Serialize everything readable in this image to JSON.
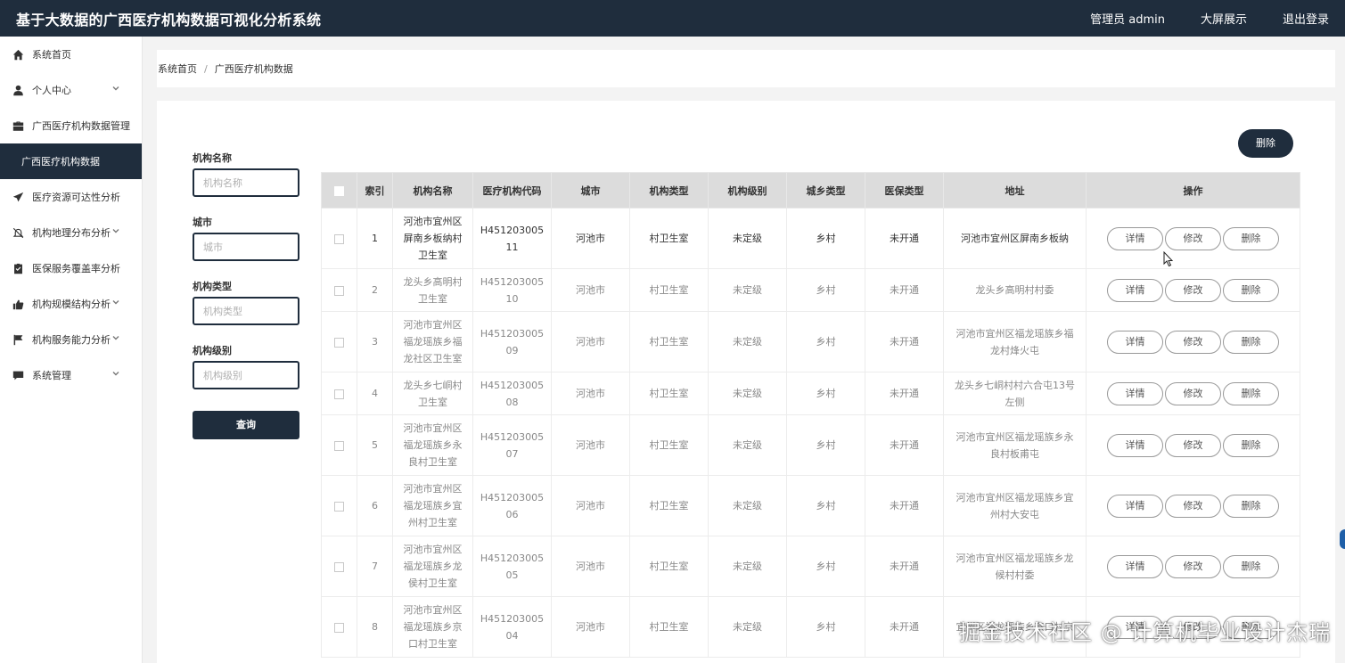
{
  "app": {
    "title": "基于大数据的广西医疗机构数据可视化分析系统",
    "admin_label": "管理员 admin",
    "bigscreen_label": "大屏展示",
    "logout_label": "退出登录"
  },
  "sidebar": {
    "items": [
      {
        "label": "系统首页",
        "icon": "home-icon"
      },
      {
        "label": "个人中心",
        "icon": "user-icon",
        "chevron": true
      },
      {
        "label": "广西医疗机构数据管理",
        "icon": "briefcase-icon"
      },
      {
        "label": "广西医疗机构数据",
        "active": true
      },
      {
        "label": "医疗资源可达性分析",
        "icon": "send-icon"
      },
      {
        "label": "机构地理分布分析",
        "icon": "bell-off-icon",
        "chevron": true
      },
      {
        "label": "医保服务覆盖率分析",
        "icon": "clipboard-icon"
      },
      {
        "label": "机构规模结构分析",
        "icon": "thumbs-up-icon",
        "chevron": true
      },
      {
        "label": "机构服务能力分析",
        "icon": "flag-icon",
        "chevron": true
      },
      {
        "label": "系统管理",
        "icon": "chat-icon",
        "chevron": true
      }
    ]
  },
  "breadcrumb": {
    "home": "系统首页",
    "separator": "/",
    "current": "广西医疗机构数据"
  },
  "search": {
    "name_label": "机构名称",
    "name_placeholder": "机构名称",
    "city_label": "城市",
    "city_placeholder": "城市",
    "type_label": "机构类型",
    "type_placeholder": "机构类型",
    "level_label": "机构级别",
    "level_placeholder": "机构级别",
    "query_button": "查询"
  },
  "toolbar": {
    "delete_label": "删除"
  },
  "table": {
    "columns": [
      "索引",
      "机构名称",
      "医疗机构代码",
      "城市",
      "机构类型",
      "机构级别",
      "城乡类型",
      "医保类型",
      "地址",
      "操作"
    ],
    "actions": {
      "detail": "详情",
      "edit": "修改",
      "delete": "删除"
    },
    "rows": [
      {
        "index": "1",
        "name": "河池市宜州区屏南乡板纳村卫生室",
        "code": "H45120300511",
        "city": "河池市",
        "type": "村卫生室",
        "level": "未定级",
        "area": "乡村",
        "insurance": "未开通",
        "address": "河池市宜州区屏南乡板纳"
      },
      {
        "index": "2",
        "name": "龙头乡高明村卫生室",
        "code": "H45120300510",
        "city": "河池市",
        "type": "村卫生室",
        "level": "未定级",
        "area": "乡村",
        "insurance": "未开通",
        "address": "龙头乡高明村村委"
      },
      {
        "index": "3",
        "name": "河池市宜州区福龙瑶族乡福龙社区卫生室",
        "code": "H45120300509",
        "city": "河池市",
        "type": "村卫生室",
        "level": "未定级",
        "area": "乡村",
        "insurance": "未开通",
        "address": "河池市宜州区福龙瑶族乡福龙村烽火屯"
      },
      {
        "index": "4",
        "name": "龙头乡七峒村卫生室",
        "code": "H45120300508",
        "city": "河池市",
        "type": "村卫生室",
        "level": "未定级",
        "area": "乡村",
        "insurance": "未开通",
        "address": "龙头乡七峒村村六合屯13号左侧"
      },
      {
        "index": "5",
        "name": "河池市宜州区福龙瑶族乡永良村卫生室",
        "code": "H45120300507",
        "city": "河池市",
        "type": "村卫生室",
        "level": "未定级",
        "area": "乡村",
        "insurance": "未开通",
        "address": "河池市宜州区福龙瑶族乡永良村板甫屯"
      },
      {
        "index": "6",
        "name": "河池市宜州区福龙瑶族乡宜州村卫生室",
        "code": "H45120300506",
        "city": "河池市",
        "type": "村卫生室",
        "level": "未定级",
        "area": "乡村",
        "insurance": "未开通",
        "address": "河池市宜州区福龙瑶族乡宜州村大安屯"
      },
      {
        "index": "7",
        "name": "河池市宜州区福龙瑶族乡龙侯村卫生室",
        "code": "H45120300505",
        "city": "河池市",
        "type": "村卫生室",
        "level": "未定级",
        "area": "乡村",
        "insurance": "未开通",
        "address": "河池市宜州区福龙瑶族乡龙候村村委"
      },
      {
        "index": "8",
        "name": "河池市宜州区福龙瑶族乡京口村卫生室",
        "code": "H45120300504",
        "city": "河池市",
        "type": "村卫生室",
        "level": "未定级",
        "area": "乡村",
        "insurance": "未开通",
        "address": "宜州区福龙瑶族乡京口村京"
      }
    ]
  },
  "watermark": "掘金技术社区 @ 计算机毕业设计杰瑞"
}
